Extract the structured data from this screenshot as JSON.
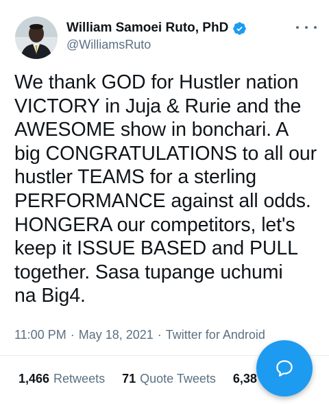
{
  "author": {
    "display_name": "William Samoei Ruto, PhD",
    "handle": "@WilliamsRuto",
    "verified": true
  },
  "tweet": {
    "text": "We thank GOD for Hustler nation\nVICTORY in Juja & Rurie and the\nAWESOME show in bonchari. A\nbig CONGRATULATIONS to all our\nhustler TEAMS for a sterling\nPERFORMANCE against all odds.\nHONGERA our competitors, let's\nkeep it ISSUE BASED and PULL\ntogether. Sasa tupange uchumi\nna Big4.",
    "time": "11:00 PM",
    "date": "May 18, 2021",
    "source": "Twitter for Android",
    "separator": "·"
  },
  "stats": {
    "retweets_count": "1,466",
    "retweets_label": "Retweets",
    "quote_count": "71",
    "quote_label": "Quote Tweets",
    "likes_count_partial": "6,38"
  },
  "icons": {
    "verified": "verified-badge-icon",
    "more": "more-options-icon",
    "compose": "reply-bubble-icon"
  },
  "colors": {
    "accent": "#1d9bf0",
    "secondary_text": "#5b7083",
    "primary_text": "#0f1419"
  }
}
